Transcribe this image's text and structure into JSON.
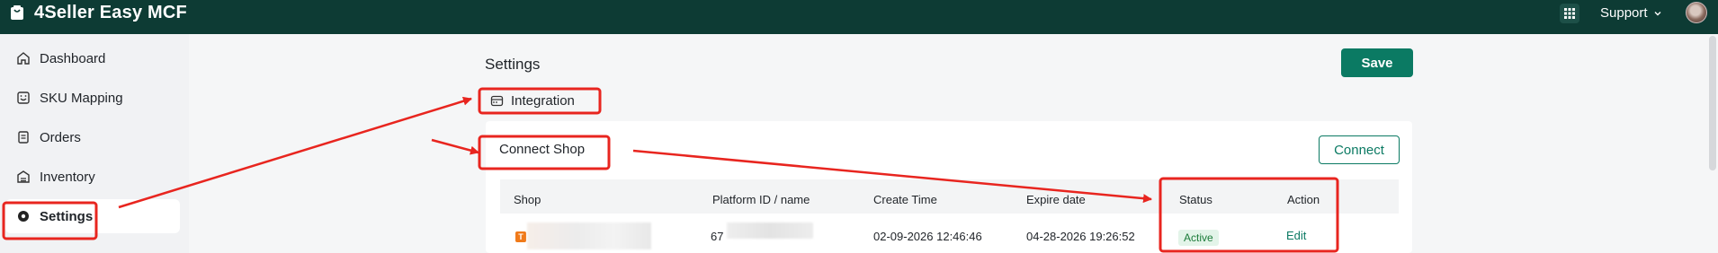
{
  "app": {
    "title": "4Seller Easy MCF",
    "logo_icon": "shopping-bag-icon",
    "brand_color": "#0d3b34"
  },
  "topbar": {
    "apps_icon": "grid-icon",
    "support_label": "Support",
    "chevron_icon": "chevron-down-icon",
    "avatar": "avatar"
  },
  "sidebar": {
    "items": [
      {
        "label": "Dashboard",
        "icon": "home-icon",
        "active": false
      },
      {
        "label": "SKU Mapping",
        "icon": "mapping-icon",
        "active": false
      },
      {
        "label": "Orders",
        "icon": "orders-icon",
        "active": false
      },
      {
        "label": "Inventory",
        "icon": "inventory-icon",
        "active": false
      },
      {
        "label": "Settings",
        "icon": "settings-icon",
        "active": true
      }
    ]
  },
  "main": {
    "title": "Settings",
    "save_label": "Save",
    "integration_label": "Integration",
    "integration_icon": "store-icon",
    "connect_shop": {
      "title": "Connect Shop",
      "connect_label": "Connect",
      "columns": [
        "Shop",
        "Platform ID / name",
        "Create Time",
        "Expire date",
        "Status",
        "Action"
      ],
      "rows": [
        {
          "shop": "",
          "shop_badge": "T",
          "platform_id": "67",
          "create_time": "02-09-2026 12:46:46",
          "expire_date": "04-28-2026 19:26:52",
          "status": "Active",
          "action": "Edit"
        }
      ]
    }
  },
  "colors": {
    "accent": "#0b7a63",
    "annotation": "#e8251f",
    "status_active_bg": "#e3f4e9",
    "status_active_text": "#1c7c3a"
  }
}
